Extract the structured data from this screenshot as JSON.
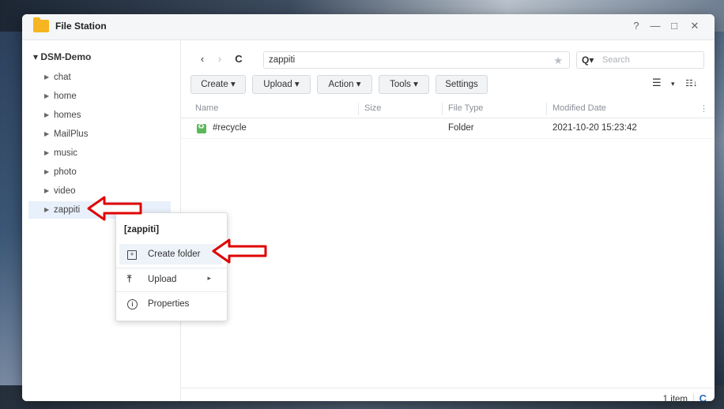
{
  "window": {
    "title": "File Station",
    "help_label": "?",
    "minimize_label": "—",
    "maximize_label": "□",
    "close_label": "✕"
  },
  "sidebar": {
    "root": "▾ DSM-Demo",
    "items": [
      {
        "label": "chat"
      },
      {
        "label": "home"
      },
      {
        "label": "homes"
      },
      {
        "label": "MailPlus"
      },
      {
        "label": "music"
      },
      {
        "label": "photo"
      },
      {
        "label": "video"
      },
      {
        "label": "zappiti"
      }
    ]
  },
  "toolbar": {
    "back": "‹",
    "forward": "›",
    "refresh": "C",
    "path": "zappiti",
    "star": "★",
    "search_icon": "Q▾",
    "search_placeholder": "Search",
    "buttons": [
      "Create ▾",
      "Upload ▾",
      "Action ▾",
      "Tools ▾",
      "Settings"
    ],
    "list_view": "☰",
    "view_dropdown": "▾",
    "sort": "☷↓"
  },
  "table": {
    "headers": [
      "Name",
      "Size",
      "File Type",
      "Modified Date"
    ],
    "more": "⋮",
    "rows": [
      {
        "name": "#recycle",
        "size": "",
        "type": "Folder",
        "modified": "2021-10-20 15:23:42"
      }
    ]
  },
  "footer": {
    "count": "1 item",
    "refresh": "C"
  },
  "context_menu": {
    "title": "[zappiti]",
    "items": [
      {
        "label": "Create folder",
        "icon": "create-folder-icon"
      },
      {
        "label": "Upload",
        "icon": "upload-icon"
      },
      {
        "label": "Properties",
        "icon": "info-icon"
      }
    ],
    "submenu_arrow": "▸"
  },
  "colors": {
    "accent": "#2a6ebb",
    "annotation_arrow": "#e00000",
    "folder_icon": "#f7b521",
    "recycle_icon": "#5cb85c"
  }
}
